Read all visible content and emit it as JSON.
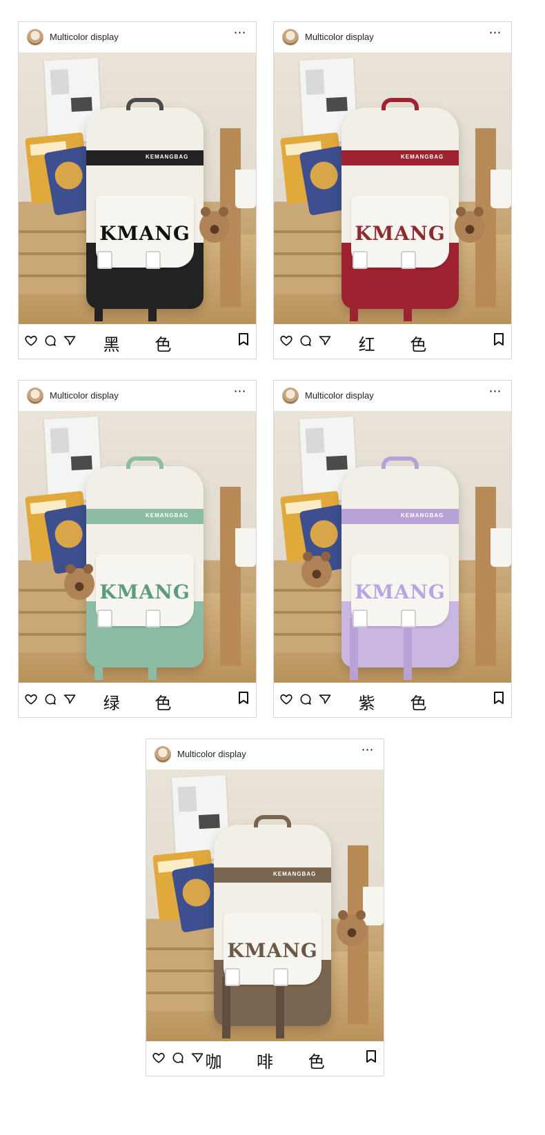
{
  "cards": [
    {
      "username": "Multicolor display",
      "color_label": "黑 色",
      "bag_logo": "KMANG",
      "bag_stripe_text": "KEMANGBAG",
      "accent": "#1f1f1f",
      "logo_color": "#333333",
      "bear_side": "right"
    },
    {
      "username": "Multicolor display",
      "color_label": "红 色",
      "bag_logo": "KMANG",
      "bag_stripe_text": "KEMANGBAG",
      "accent": "#9e2230",
      "logo_color": "#8f2a2e",
      "bear_side": "right"
    },
    {
      "username": "Multicolor display",
      "color_label": "绿 色",
      "bag_logo": "KMANG",
      "bag_stripe_text": "KEMANGBAG",
      "accent": "#8cbca4",
      "logo_color": "#5c9b7e",
      "bear_side": "left"
    },
    {
      "username": "Multicolor display",
      "color_label": "紫 色",
      "bag_logo": "KMANG",
      "bag_stripe_text": "KEMANGBAG",
      "accent": "#b7a1d6",
      "logo_color": "#b8a3e3",
      "bear_side": "left"
    },
    {
      "username": "Multicolor display",
      "color_label": "咖 啡 色",
      "bag_logo": "KMANG",
      "bag_stripe_text": "KEMANGBAG",
      "accent": "#7a6650",
      "logo_color": "#6c5847",
      "bear_side": "right"
    }
  ],
  "icons": {
    "like": "heart-icon",
    "comment": "comment-icon",
    "share": "send-icon",
    "save": "bookmark-icon",
    "more": "more-icon"
  }
}
